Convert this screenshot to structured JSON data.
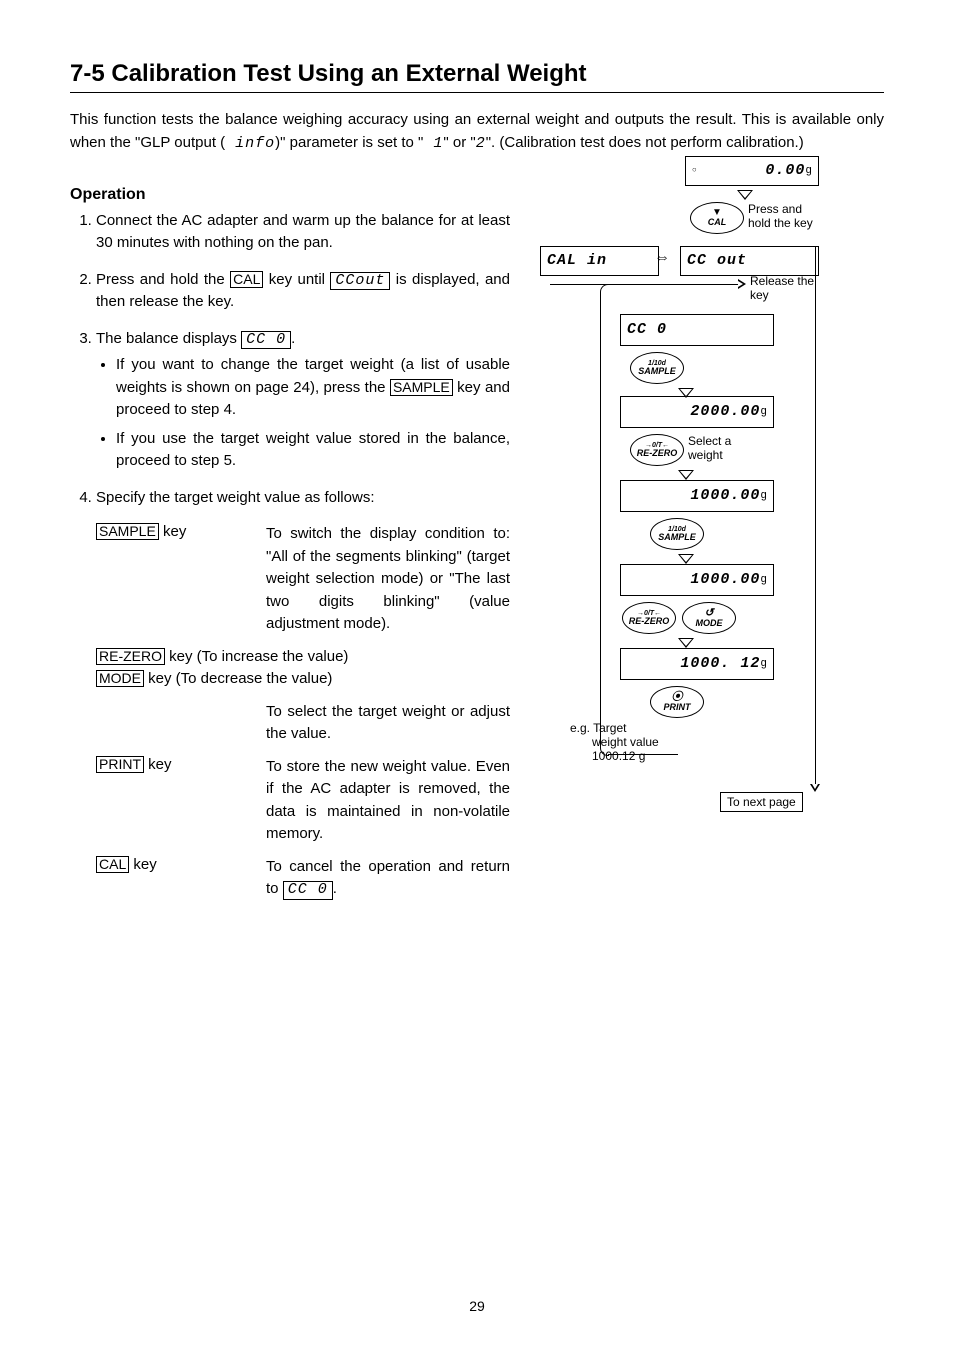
{
  "title": "7-5  Calibration Test Using an External Weight",
  "intro_parts": {
    "p1": "This function tests the balance weighing accuracy using an external weight and outputs the result. This is available only when the \"GLP output (",
    "seg": " info",
    "p2": ")\" parameter is set to \"",
    "v1": " 1",
    "p3": "\" or \"",
    "v2": "2",
    "p4": "\". (Calibration test does not perform calibration.)"
  },
  "operation_label": "Operation",
  "steps": {
    "s1": "Connect the AC adapter and warm up the balance for at least 30 minutes with nothing on the pan.",
    "s2a": "Press and hold the ",
    "s2key": "CAL",
    "s2b": " key until ",
    "s2seg": " CCout ",
    "s2c": " is displayed, and then release the key.",
    "s3a": "The balance displays ",
    "s3seg": " CC   0 ",
    "s3dot": ".",
    "s3b1a": "If you want to change the target weight (a list of usable weights is shown on page 24), press the ",
    "s3b1key": "SAMPLE",
    "s3b1b": " key and proceed to step 4.",
    "s3b2": "If you use the target weight value stored in the balance, proceed to step 5.",
    "s4": "Specify the target weight value as follows:"
  },
  "keydefs": {
    "sample_key": "SAMPLE",
    "sample_suffix": " key",
    "sample_desc": "To switch the display condition to: \"All of the segments blinking\" (target weight selection mode) or \"The last two digits blinking\" (value adjustment mode).",
    "rezero_key": "RE-ZERO",
    "rezero_line": " key (To increase the value)",
    "mode_key": "MODE",
    "mode_line": " key (To decrease the value)",
    "select_desc": "To select the target weight or adjust the value.",
    "print_key": "PRINT",
    "print_suffix": " key",
    "print_desc": "To store the new weight value. Even if the AC adapter is removed, the data is maintained in non-volatile memory.",
    "cal_key": "CAL",
    "cal_suffix": " key",
    "cal_desc_a": "To cancel the operation and return to ",
    "cal_seg": " CC   0 ",
    "cal_desc_b": "."
  },
  "diagram": {
    "lcd_000": "0.00",
    "unit_g": "g",
    "press_hold": "Press and hold the key",
    "cal_in": "CAL  in",
    "cc_out": "CC  out",
    "release": "Release the key",
    "cc_0": "CC      0",
    "d2000": "2000.00",
    "select_weight": "Select a weight",
    "d1000": "1000.00",
    "d1000b": "1000.00",
    "d100012": "1000. 12",
    "btn_cal": "CAL",
    "btn_sample_top": "1/10d",
    "btn_sample": "SAMPLE",
    "btn_rezero_top": "→0/T←",
    "btn_rezero": "RE-ZERO",
    "btn_mode_top": "↺",
    "btn_mode": "MODE",
    "btn_print_top": "⦿",
    "btn_print": "PRINT",
    "eg1": "e.g. Target",
    "eg2": "weight value",
    "eg3": "1000.12 g",
    "nextpage": "To next page",
    "circle_indicator": "○"
  },
  "page_number": "29"
}
